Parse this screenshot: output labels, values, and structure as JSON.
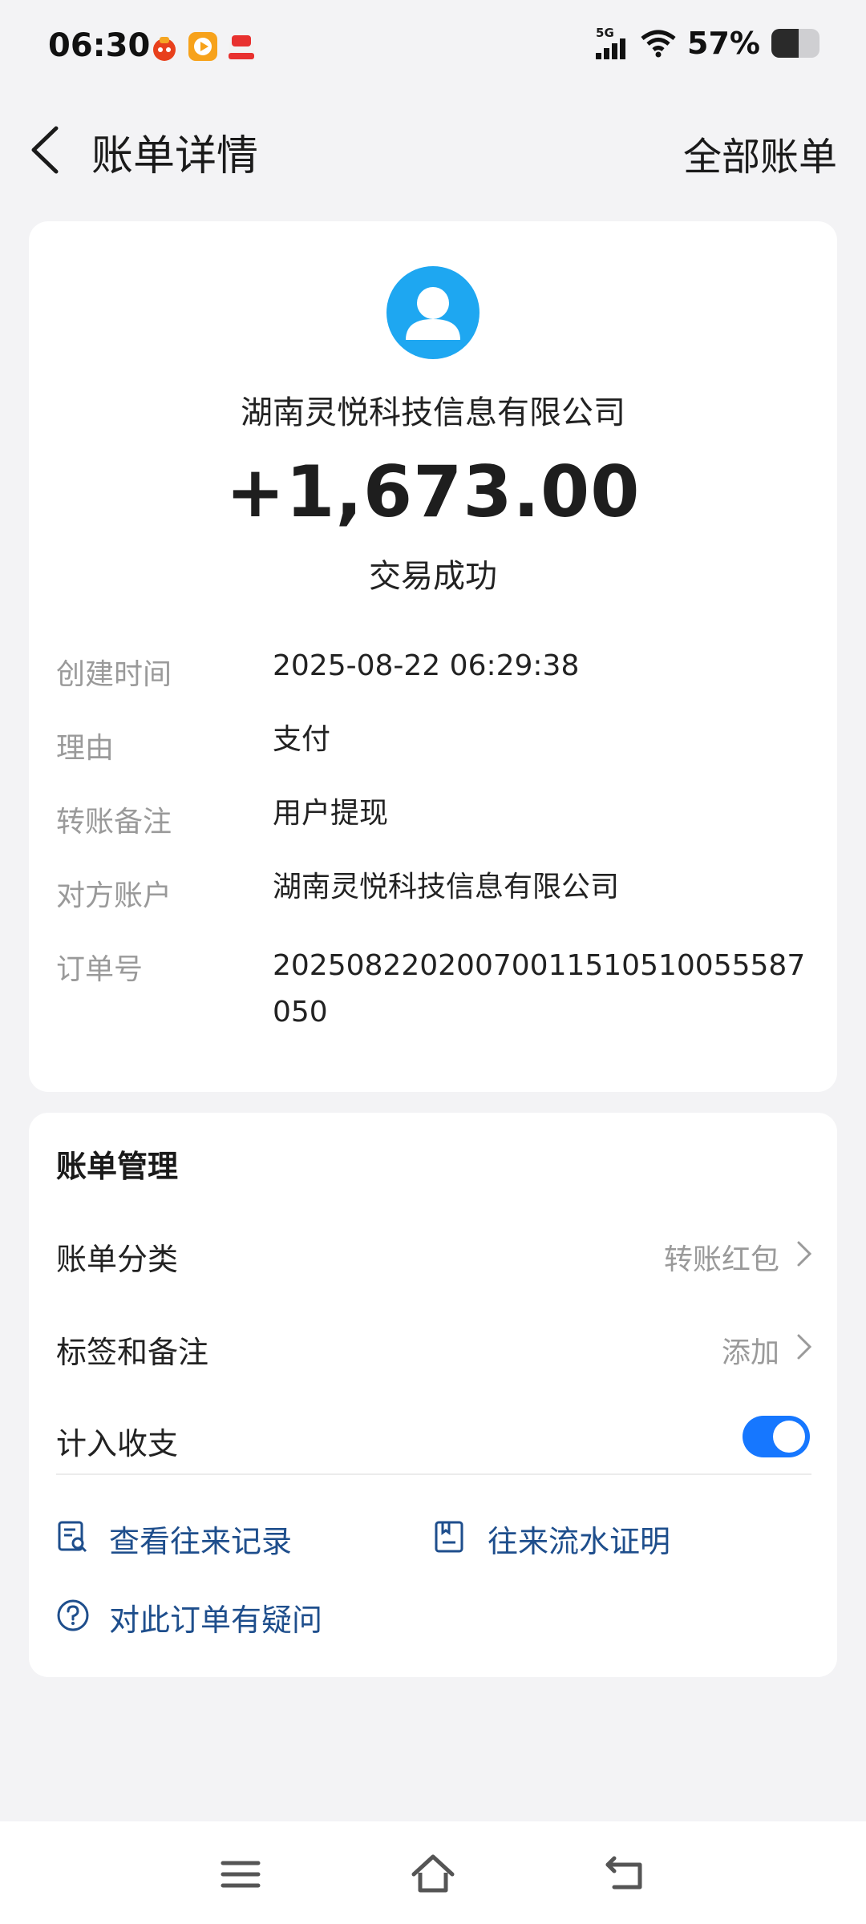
{
  "status_bar": {
    "time": "06:30",
    "network": "5G",
    "battery": "57%",
    "battery_level": 0.57,
    "icons": [
      "notification-app-icon",
      "video-app-icon",
      "gift-app-icon",
      "signal-icon",
      "wifi-icon",
      "battery-icon"
    ]
  },
  "header": {
    "back_icon": "chevron-left-icon",
    "title": "账单详情",
    "right_link": "全部账单"
  },
  "transaction": {
    "avatar_icon": "user-avatar-icon",
    "counterparty": "湖南灵悦科技信息有限公司",
    "amount": "+1,673.00",
    "status": "交易成功",
    "details": [
      {
        "label": "创建时间",
        "value": "2025-08-22 06:29:38"
      },
      {
        "label": "理由",
        "value": "支付"
      },
      {
        "label": "转账备注",
        "value": "用户提现"
      },
      {
        "label": "对方账户",
        "value": "湖南灵悦科技信息有限公司"
      },
      {
        "label": "订单号",
        "value": "20250822020070011510510055587050"
      }
    ]
  },
  "management": {
    "title": "账单管理",
    "category_label": "账单分类",
    "category_value": "转账红包",
    "tags_label": "标签和备注",
    "tags_value": "添加",
    "include_label": "计入收支",
    "include_on": true,
    "links": {
      "records": "查看往来记录",
      "statement": "往来流水证明",
      "question": "对此订单有疑问"
    },
    "link_color": "#1e4e8c",
    "accent_color": "#1677ff"
  },
  "nav_bar": {
    "icons": [
      "menu-icon",
      "home-icon",
      "back-icon"
    ]
  }
}
